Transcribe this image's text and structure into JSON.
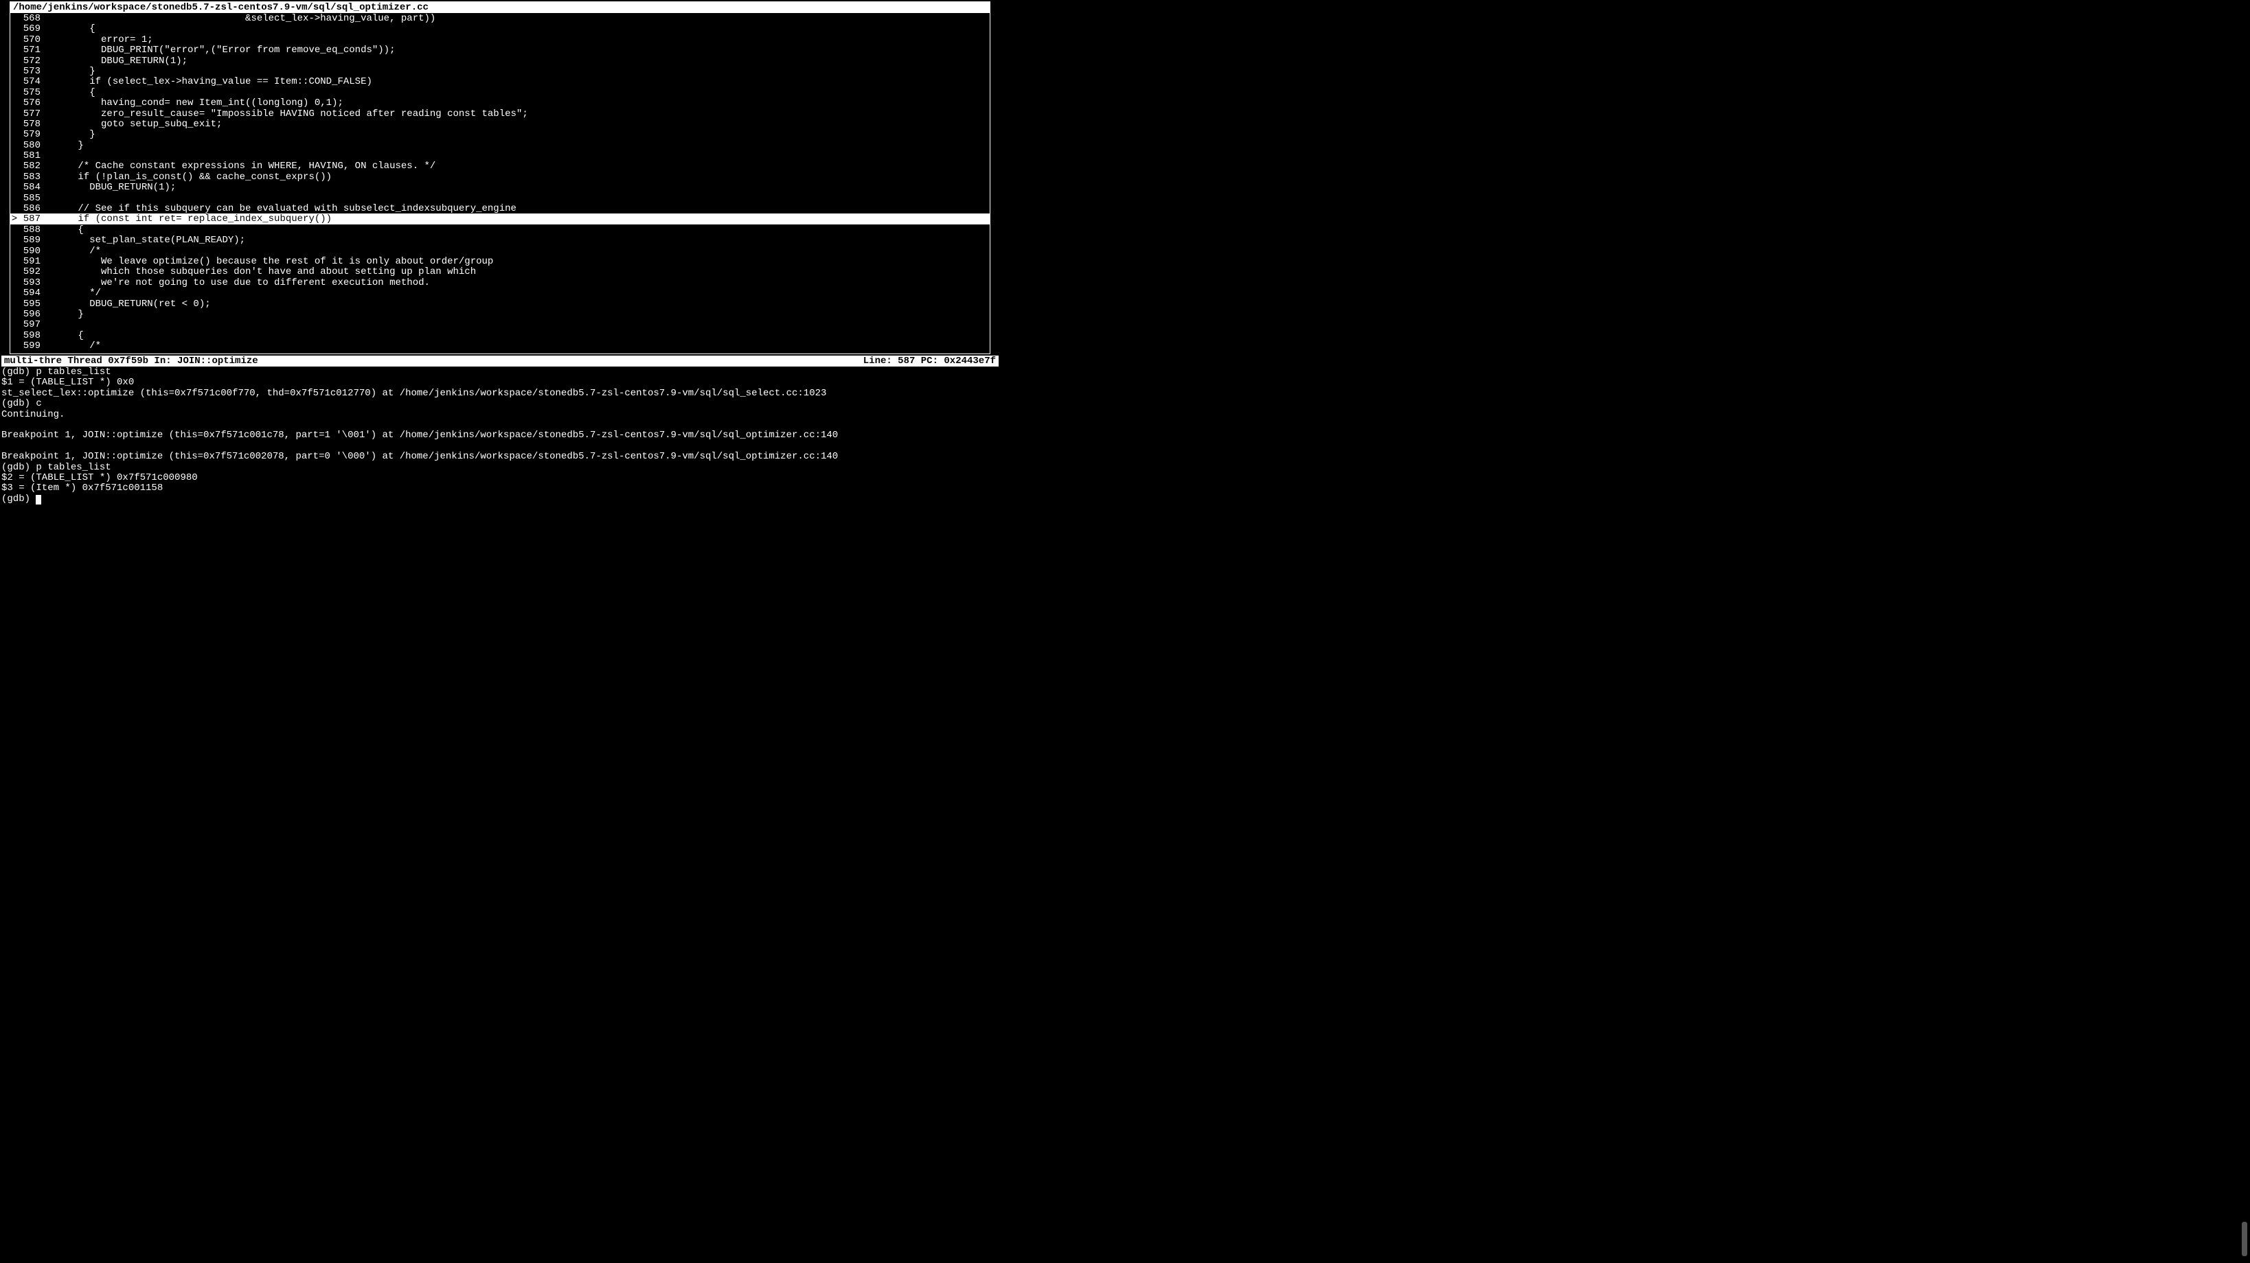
{
  "title": "/home/jenkins/workspace/stonedb5.7-zsl-centos7.9-vm/sql/sql_optimizer.cc",
  "current_line": 587,
  "pc": "0x2443e7f",
  "thread_info": "multi-thre Thread 0x7f59b In: JOIN::optimize",
  "status_right": "Line: 587   PC: 0x2443e7f",
  "source": [
    {
      "n": 568,
      "bp": "",
      "t": "                                   &select_lex->having_value, part))"
    },
    {
      "n": 569,
      "bp": "",
      "t": "        {"
    },
    {
      "n": 570,
      "bp": "",
      "t": "          error= 1;"
    },
    {
      "n": 571,
      "bp": "",
      "t": "          DBUG_PRINT(\"error\",(\"Error from remove_eq_conds\"));"
    },
    {
      "n": 572,
      "bp": "",
      "t": "          DBUG_RETURN(1);"
    },
    {
      "n": 573,
      "bp": "",
      "t": "        }"
    },
    {
      "n": 574,
      "bp": "",
      "t": "        if (select_lex->having_value == Item::COND_FALSE)"
    },
    {
      "n": 575,
      "bp": "",
      "t": "        {"
    },
    {
      "n": 576,
      "bp": "",
      "t": "          having_cond= new Item_int((longlong) 0,1);"
    },
    {
      "n": 577,
      "bp": "",
      "t": "          zero_result_cause= \"Impossible HAVING noticed after reading const tables\";"
    },
    {
      "n": 578,
      "bp": "",
      "t": "          goto setup_subq_exit;"
    },
    {
      "n": 579,
      "bp": "",
      "t": "        }"
    },
    {
      "n": 580,
      "bp": "",
      "t": "      }"
    },
    {
      "n": 581,
      "bp": "",
      "t": ""
    },
    {
      "n": 582,
      "bp": "",
      "t": "      /* Cache constant expressions in WHERE, HAVING, ON clauses. */"
    },
    {
      "n": 583,
      "bp": "",
      "t": "      if (!plan_is_const() && cache_const_exprs())"
    },
    {
      "n": 584,
      "bp": "",
      "t": "        DBUG_RETURN(1);"
    },
    {
      "n": 585,
      "bp": "",
      "t": ""
    },
    {
      "n": 586,
      "bp": "",
      "t": "      // See if this subquery can be evaluated with subselect_indexsubquery_engine"
    },
    {
      "n": 587,
      "bp": ">",
      "t": "      if (const int ret= replace_index_subquery())",
      "current": true
    },
    {
      "n": 588,
      "bp": "",
      "t": "      {"
    },
    {
      "n": 589,
      "bp": "",
      "t": "        set_plan_state(PLAN_READY);"
    },
    {
      "n": 590,
      "bp": "",
      "t": "        /*"
    },
    {
      "n": 591,
      "bp": "",
      "t": "          We leave optimize() because the rest of it is only about order/group"
    },
    {
      "n": 592,
      "bp": "",
      "t": "          which those subqueries don't have and about setting up plan which"
    },
    {
      "n": 593,
      "bp": "",
      "t": "          we're not going to use due to different execution method."
    },
    {
      "n": 594,
      "bp": "",
      "t": "        */"
    },
    {
      "n": 595,
      "bp": "",
      "t": "        DBUG_RETURN(ret < 0);"
    },
    {
      "n": 596,
      "bp": "",
      "t": "      }"
    },
    {
      "n": 597,
      "bp": "",
      "t": ""
    },
    {
      "n": 598,
      "bp": "",
      "t": "      {"
    },
    {
      "n": 599,
      "bp": "",
      "t": "        /*"
    }
  ],
  "console": [
    "(gdb) p tables_list",
    "$1 = (TABLE_LIST *) 0x0",
    "st_select_lex::optimize (this=0x7f571c00f770, thd=0x7f571c012770) at /home/jenkins/workspace/stonedb5.7-zsl-centos7.9-vm/sql/sql_select.cc:1023",
    "(gdb) c",
    "Continuing.",
    "",
    "Breakpoint 1, JOIN::optimize (this=0x7f571c001c78, part=1 '\\001') at /home/jenkins/workspace/stonedb5.7-zsl-centos7.9-vm/sql/sql_optimizer.cc:140",
    "",
    "Breakpoint 1, JOIN::optimize (this=0x7f571c002078, part=0 '\\000') at /home/jenkins/workspace/stonedb5.7-zsl-centos7.9-vm/sql/sql_optimizer.cc:140",
    "(gdb) p tables_list",
    "$2 = (TABLE_LIST *) 0x7f571c000980",
    "$3 = (Item *) 0x7f571c001158"
  ],
  "prompt": "(gdb) "
}
